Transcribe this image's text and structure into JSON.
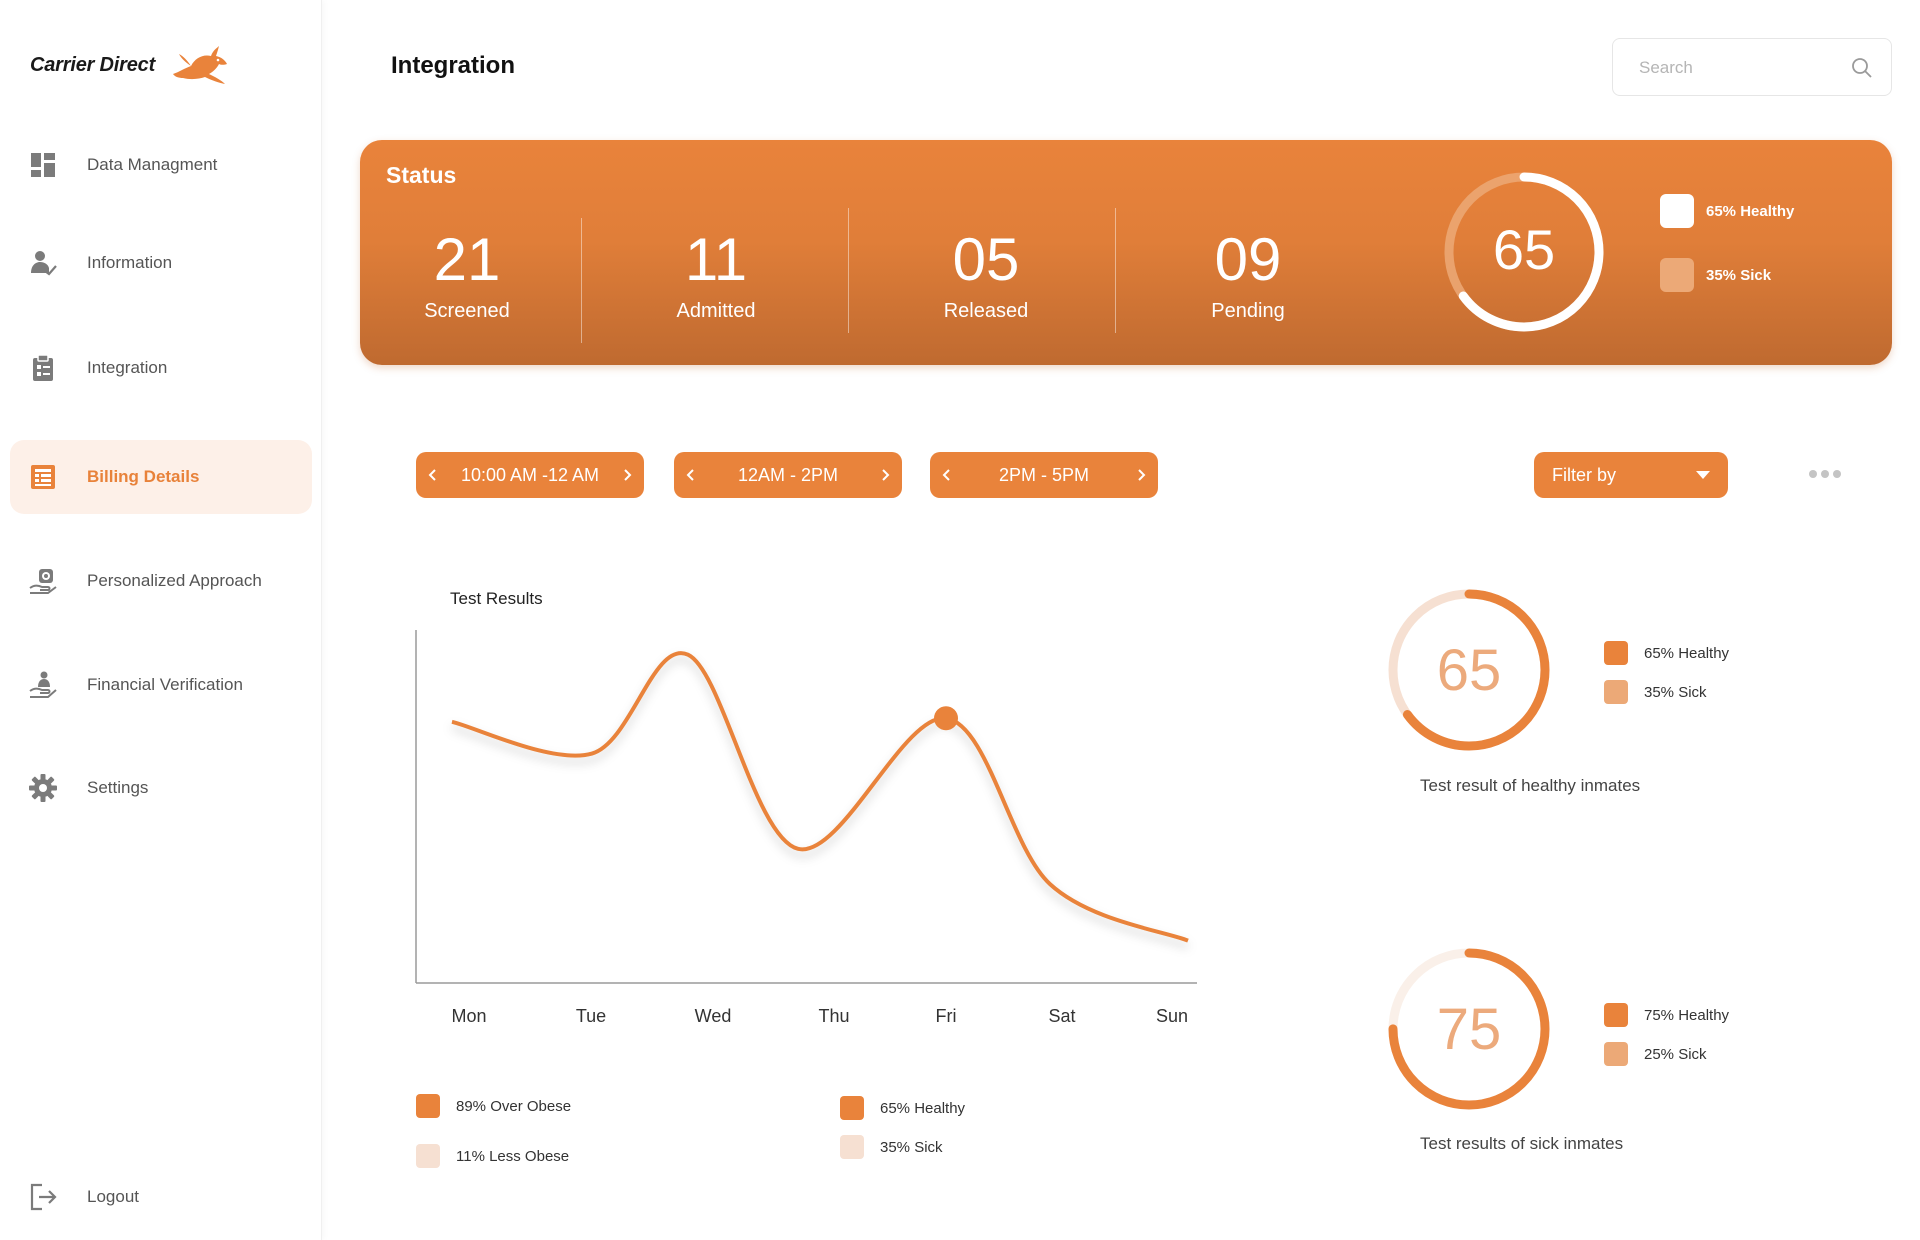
{
  "brand": {
    "name": "Carrier Direct",
    "logo_icon": "rabbit-logo-icon"
  },
  "sidebar": {
    "items": [
      {
        "label": "Data Managment",
        "icon": "dashboard-icon"
      },
      {
        "label": "Information",
        "icon": "user-info-icon"
      },
      {
        "label": "Integration",
        "icon": "clipboard-icon"
      },
      {
        "label": "Billing Details",
        "icon": "billing-icon",
        "active": true
      },
      {
        "label": "Personalized Approach",
        "icon": "hand-coin-icon"
      },
      {
        "label": "Financial Verification",
        "icon": "hand-person-icon"
      },
      {
        "label": "Settings",
        "icon": "gear-icon"
      }
    ],
    "logout": {
      "label": "Logout",
      "icon": "logout-icon"
    }
  },
  "header": {
    "title": "Integration",
    "search_placeholder": "Search"
  },
  "status": {
    "title": "Status",
    "stats": [
      {
        "value": "21",
        "label": "Screened"
      },
      {
        "value": "11",
        "label": "Admitted"
      },
      {
        "value": "05",
        "label": "Released"
      },
      {
        "value": "09",
        "label": "Pending"
      }
    ],
    "donut_value": "65",
    "donut_fraction": 0.65,
    "legend": [
      {
        "label": "65%  Healthy",
        "color": "#ffffff"
      },
      {
        "label": "35%  Sick",
        "color": "#eca977"
      }
    ]
  },
  "time_filters": [
    {
      "label": "10:00 AM -12 AM"
    },
    {
      "label": "12AM - 2PM"
    },
    {
      "label": "2PM - 5PM"
    }
  ],
  "filter": {
    "label": "Filter by"
  },
  "colors": {
    "accent": "#e9833b",
    "accent_light": "#eca977",
    "accent_pale": "#f6e0d2"
  },
  "chart_data": {
    "type": "line",
    "title": "Test Results",
    "categories": [
      "Mon",
      "Tue",
      "Wed",
      "Thu",
      "Fri",
      "Sat",
      "Sun"
    ],
    "series": [
      {
        "values": [
          0.74,
          0.65,
          0.93,
          0.38,
          0.75,
          0.28,
          0.12
        ],
        "highlighted_index": 4
      }
    ],
    "grid": false,
    "legend": [
      {
        "label": "89% Over Obese",
        "color": "#e9833b"
      },
      {
        "label": "11% Less Obese",
        "color": "#f6e0d2"
      },
      {
        "label": "65% Healthy",
        "color": "#e9833b"
      },
      {
        "label": "35% Sick",
        "color": "#f6e0d2"
      }
    ]
  },
  "healthy_panel": {
    "value": "65",
    "fraction": 0.65,
    "caption": "Test result of healthy inmates",
    "legend": [
      {
        "label": "65% Healthy",
        "color": "#e9833b"
      },
      {
        "label": "35% Sick",
        "color": "#eca977"
      }
    ]
  },
  "sick_panel": {
    "value": "75",
    "fraction": 0.75,
    "caption": "Test results of sick inmates",
    "legend": [
      {
        "label": "75% Healthy",
        "color": "#e9833b"
      },
      {
        "label": "25% Sick",
        "color": "#eca977"
      }
    ]
  }
}
